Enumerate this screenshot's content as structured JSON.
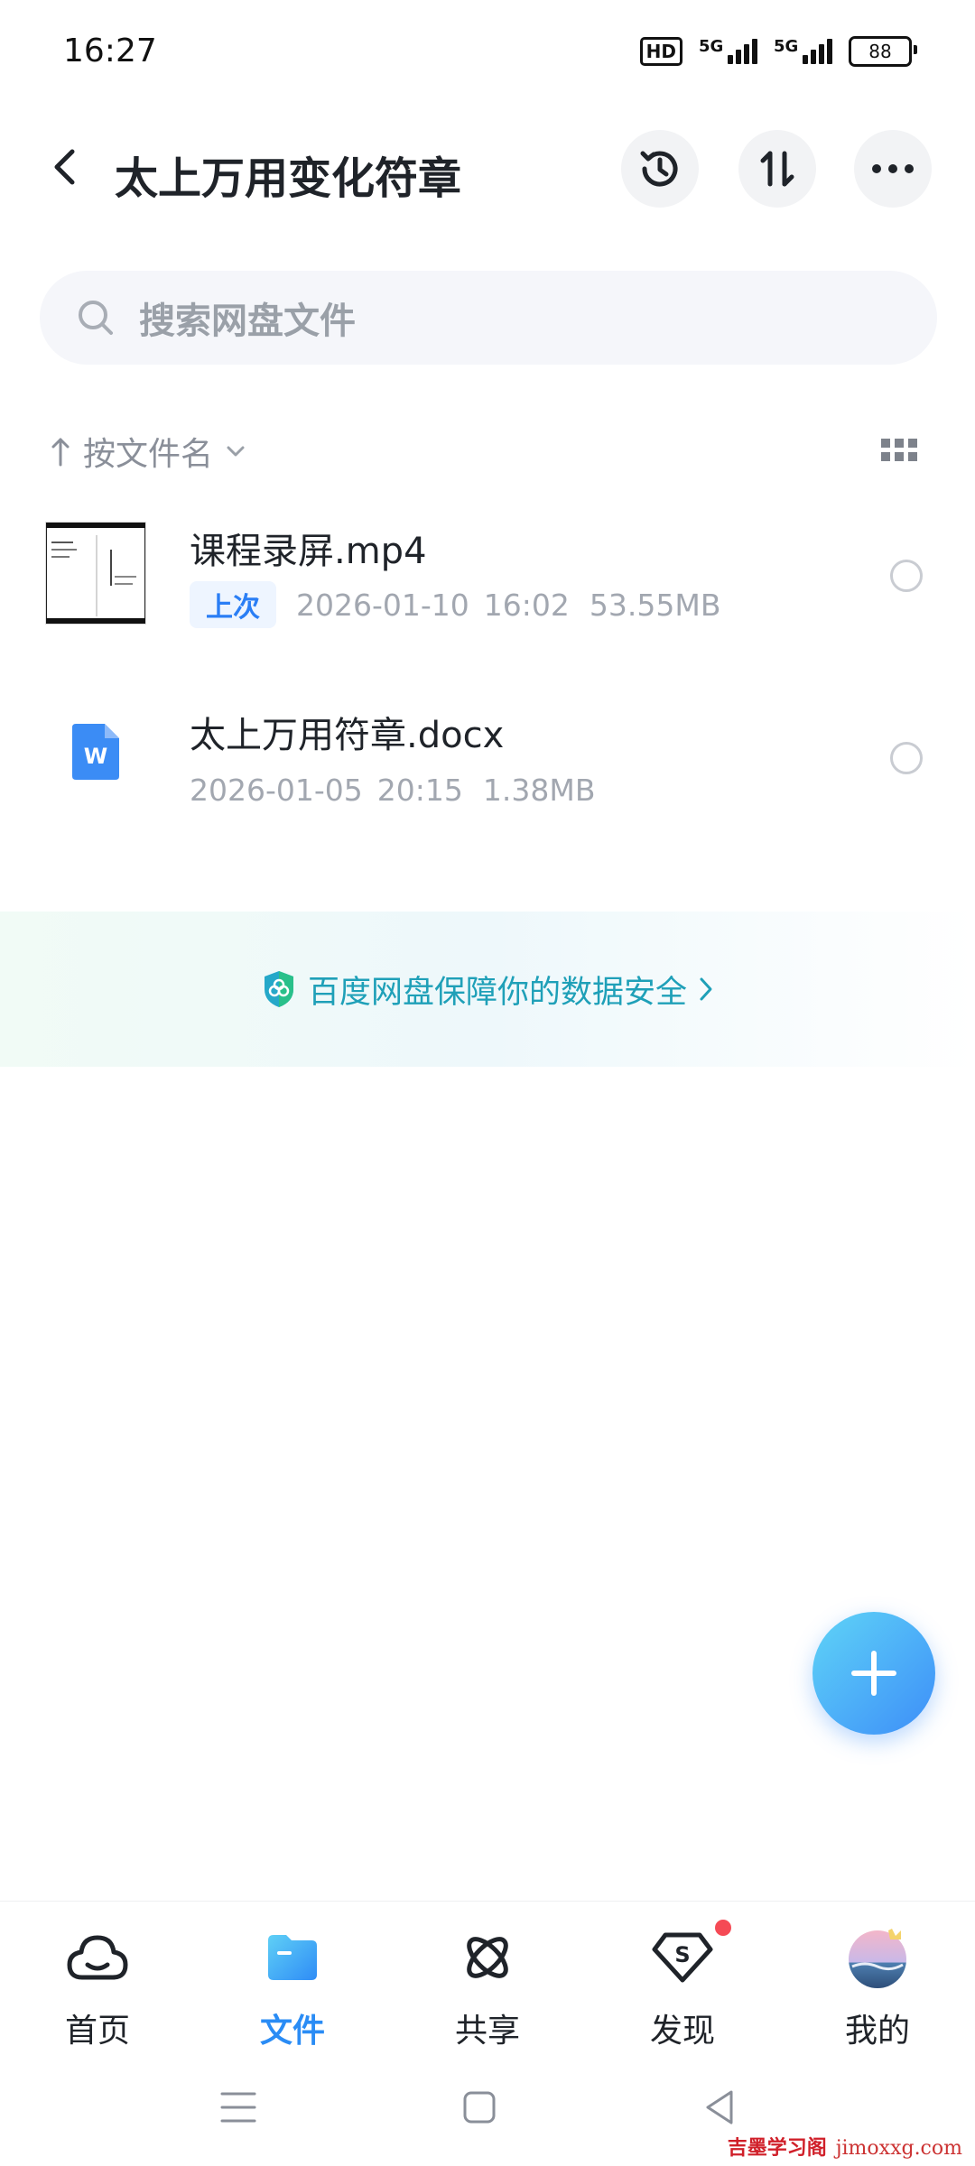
{
  "status_bar": {
    "time": "16:27",
    "hd": "HD",
    "network1": "5G",
    "network2": "5G",
    "battery": "88"
  },
  "header": {
    "title": "太上万用变化符章",
    "icons": [
      "back-icon",
      "history-icon",
      "sort-transfer-icon",
      "more-icon"
    ]
  },
  "search": {
    "placeholder": "搜索网盘文件"
  },
  "sort": {
    "label": "按文件名"
  },
  "files": [
    {
      "name": "课程录屏.mp4",
      "badge": "上次",
      "date": "2026-01-10",
      "time": "16:02",
      "size": "53.55MB",
      "type": "video"
    },
    {
      "name": "太上万用符章.docx",
      "date": "2026-01-05",
      "time": "20:15",
      "size": "1.38MB",
      "type": "word"
    }
  ],
  "security_banner": {
    "text": "百度网盘保障你的数据安全"
  },
  "bottom_nav": [
    {
      "label": "首页",
      "icon": "cloud-icon",
      "active": false
    },
    {
      "label": "文件",
      "icon": "folder-icon",
      "active": true
    },
    {
      "label": "共享",
      "icon": "share-atom-icon",
      "active": false
    },
    {
      "label": "发现",
      "icon": "discover-icon",
      "active": false
    },
    {
      "label": "我的",
      "icon": "avatar",
      "active": false
    }
  ],
  "watermark": {
    "text": "吉墨学习阁",
    "url": "jimoxxg.com"
  },
  "colors": {
    "accent": "#2a8cf5",
    "security": "#1fa0b8",
    "badge_dot": "#f54a55"
  }
}
